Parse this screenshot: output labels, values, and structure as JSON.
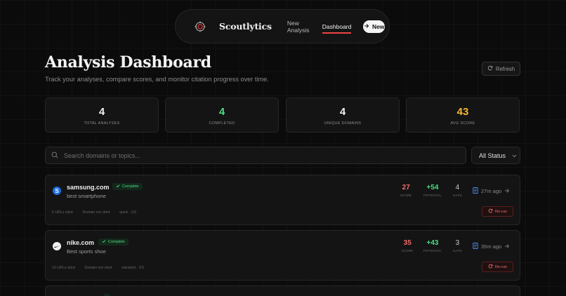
{
  "nav": {
    "brand": "Scoutlytics",
    "links": [
      "New Analysis",
      "Dashboard"
    ],
    "active": "Dashboard",
    "new_button": "New"
  },
  "header": {
    "title": "Analysis Dashboard",
    "subtitle": "Track your analyses, compare scores, and monitor citation progress over time.",
    "refresh": "Refresh"
  },
  "stats": [
    {
      "value": "4",
      "label": "TOTAL ANALYSES",
      "color": "#f2f2f2"
    },
    {
      "value": "4",
      "label": "COMPLETED",
      "color": "#4ade80"
    },
    {
      "value": "4",
      "label": "UNIQUE DOMAINS",
      "color": "#f2f2f2"
    },
    {
      "value": "43",
      "label": "AVG SCORE",
      "color": "#f5b731"
    }
  ],
  "search": {
    "placeholder": "Search domains or topics..."
  },
  "filter": {
    "selected": "All Status"
  },
  "colors": {
    "accent": "#ef4444",
    "success": "#4ade80",
    "warning": "#f5b731",
    "score_bad": "#f26b6b"
  },
  "analyses": [
    {
      "domain": "samsung.com",
      "status": "Complete",
      "topic": "best smartphone",
      "meta": [
        "5 URLs cited",
        "Domain not cited",
        "quick · US"
      ],
      "score": "27",
      "score_label": "SCORE",
      "potential": "+54",
      "potential_label": "POTENTIAL",
      "gaps": "4",
      "gaps_label": "GAPS",
      "time": "27m ago",
      "rerun": "Re-run",
      "favicon": "S"
    },
    {
      "domain": "nike.com",
      "status": "Complete",
      "topic": "Best sports shoe",
      "meta": [
        "10 URLs cited",
        "Domain not cited",
        "standard · US"
      ],
      "score": "35",
      "score_label": "SCORE",
      "potential": "+43",
      "potential_label": "POTENTIAL",
      "gaps": "3",
      "gaps_label": "GAPS",
      "time": "35m ago",
      "rerun": "Re-run",
      "favicon": "swoosh"
    }
  ]
}
